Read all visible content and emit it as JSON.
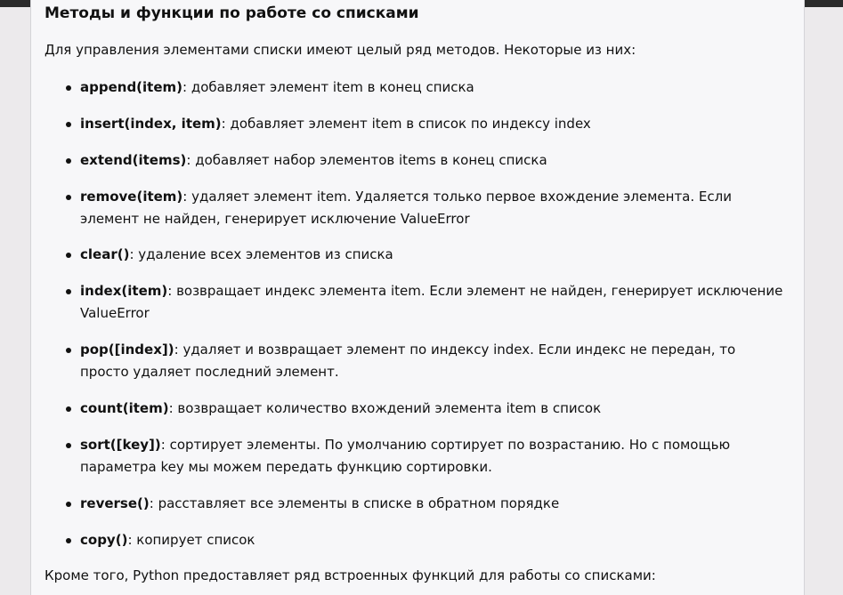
{
  "section": {
    "title": "Методы и функции по работе со списками",
    "intro": "Для управления элементами списки имеют целый ряд методов. Некоторые из них:",
    "outro": "Кроме того, Python предоставляет ряд встроенных функций для работы со списками:"
  },
  "methods": [
    {
      "name": "append(item)",
      "sep": ": ",
      "desc": "добавляет элемент item в конец списка"
    },
    {
      "name": "insert(index, item)",
      "sep": ": ",
      "desc": "добавляет элемент item в список по индексу index"
    },
    {
      "name": "extend(items)",
      "sep": ": ",
      "desc": "добавляет набор элементов items в конец списка"
    },
    {
      "name": "remove(item)",
      "sep": ": ",
      "desc": "удаляет элемент item. Удаляется только первое вхождение элемента. Если элемент не найден, генерирует исключение ValueError"
    },
    {
      "name": "clear()",
      "sep": ": ",
      "desc": "удаление всех элементов из списка"
    },
    {
      "name": "index(item)",
      "sep": ": ",
      "desc": "возвращает индекс элемента item. Если элемент не найден, генерирует исключение ValueError"
    },
    {
      "name": "pop([index])",
      "sep": ": ",
      "desc": "удаляет и возвращает элемент по индексу index. Если индекс не передан, то просто удаляет последний элемент."
    },
    {
      "name": "count(item)",
      "sep": ": ",
      "desc": "возвращает количество вхождений элемента item в список"
    },
    {
      "name": "sort([key])",
      "sep": ": ",
      "desc": "сортирует элементы. По умолчанию сортирует по возрастанию. Но с помощью параметра key мы можем передать функцию сортировки."
    },
    {
      "name": "reverse()",
      "sep": ": ",
      "desc": "расставляет все элементы в списке в обратном порядке"
    },
    {
      "name": "copy()",
      "sep": ": ",
      "desc": "копирует список"
    }
  ]
}
